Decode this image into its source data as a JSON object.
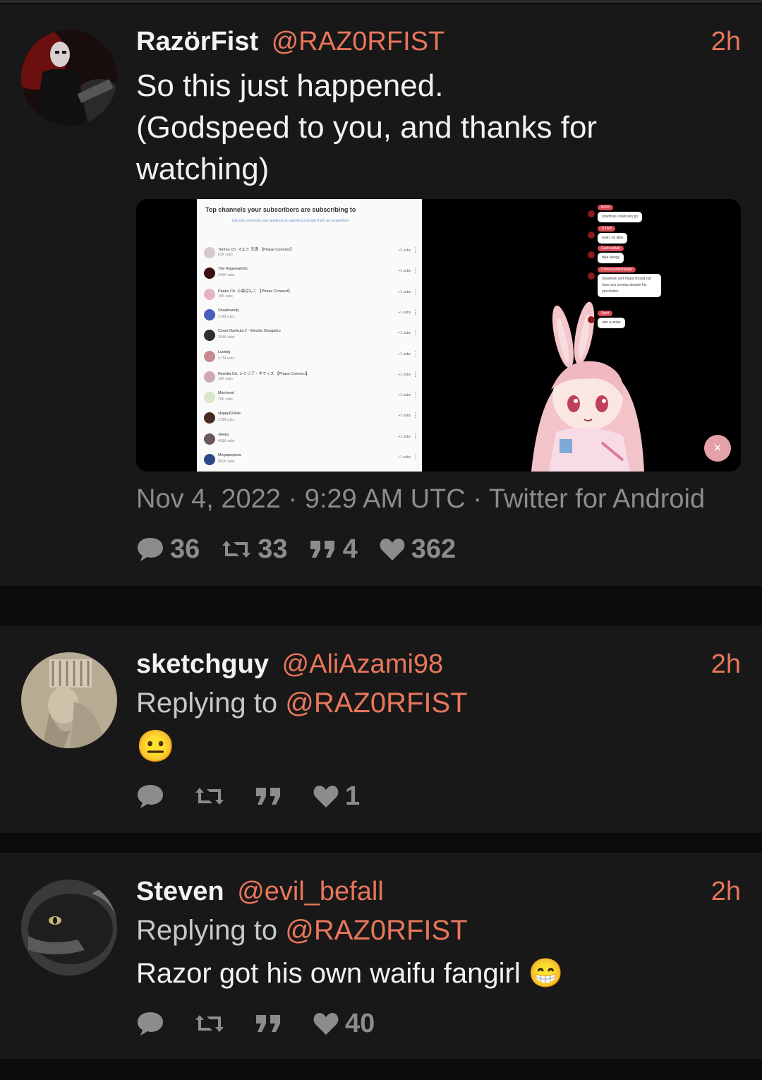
{
  "tweets": [
    {
      "display_name": "RazörFist",
      "handle": "@RAZ0RFIST",
      "time": "2h",
      "text_lines": [
        "So this just happened.",
        "(Godspeed to you, and thanks for",
        "watching)"
      ],
      "date_line": "Nov 4, 2022 · 9:29 AM UTC · Twitter for Android",
      "stats": {
        "replies": "36",
        "retweets": "33",
        "quotes": "4",
        "likes": "362"
      },
      "media": {
        "panel_title": "Top channels your subscribers are subscribing to",
        "panel_subtitle": "Discover channels your audience is watching and add them as competitors",
        "channels": [
          {
            "name": "Tenma Ch. マエミ 天満 【Phase Connect】",
            "subs": "81K subs",
            "count": "+2 subs",
            "color": "#d9c7cf"
          },
          {
            "name": "The Ragewaholic",
            "subs": "343K subs",
            "count": "+1 subs",
            "color": "#3a1010"
          },
          {
            "name": "Panko Ch. 小森ぱんこ 【Phase Connect】",
            "subs": "15K subs",
            "count": "+1 subs",
            "color": "#e6b4c0"
          },
          {
            "name": "Shadiversity",
            "subs": "1.4M subs",
            "count": "+1 subs",
            "color": "#4b5dbd"
          },
          {
            "name": "Count Dankula 2 · Electric Boogaloo",
            "subs": "304K subs",
            "count": "+1 subs",
            "color": "#303030"
          },
          {
            "name": "Ludwig",
            "subs": "3.7M subs",
            "count": "+1 subs",
            "color": "#c7888f"
          },
          {
            "name": "Remilia Ch. レミリア・ネフィス 【Phase Connect】",
            "subs": "15K subs",
            "count": "+1 subs",
            "color": "#cfa8b6"
          },
          {
            "name": "Manhood",
            "subs": "75K subs",
            "count": "+1 subs",
            "color": "#d8e6c9"
          },
          {
            "name": "skippy62able",
            "subs": "2.8M subs",
            "count": "+1 subs",
            "color": "#4a2a20"
          },
          {
            "name": "sleepy",
            "subs": "463K subs",
            "count": "+1 subs",
            "color": "#6b5560"
          },
          {
            "name": "Megaprojects",
            "subs": "851K subs",
            "count": "+1 subs",
            "color": "#2a4a8a"
          }
        ],
        "chat": [
          {
            "user": "N333",
            "message": "shadman collab lets go"
          },
          {
            "user": "JLTwin",
            "message": "yeah, no idea"
          },
          {
            "user": "Canbusblah",
            "message": "fake sleepy"
          },
          {
            "user": "Convexusflecharger",
            "message": "Shadman and Pippa should not have any overlap despite his proclivities"
          },
          {
            "user": "Spirit",
            "message": "also a writer"
          }
        ],
        "close_icon": "close-icon"
      }
    },
    {
      "display_name": "sketchguy",
      "handle": "@AliAzami98",
      "time": "2h",
      "replying_prefix": "Replying to",
      "replying_handle": "@RAZ0RFIST",
      "text": "😐",
      "stats": {
        "replies": "",
        "retweets": "",
        "quotes": "",
        "likes": "1"
      }
    },
    {
      "display_name": "Steven",
      "handle": "@evil_befall",
      "time": "2h",
      "replying_prefix": "Replying to",
      "replying_handle": "@RAZ0RFIST",
      "text": "Razor got his own waifu fangirl 😁",
      "stats": {
        "replies": "",
        "retweets": "",
        "quotes": "",
        "likes": "40"
      }
    }
  ],
  "colors": {
    "accent": "#e8765b",
    "background": "#0b0b0b",
    "card": "#181818",
    "muted": "#8c8c8c"
  }
}
